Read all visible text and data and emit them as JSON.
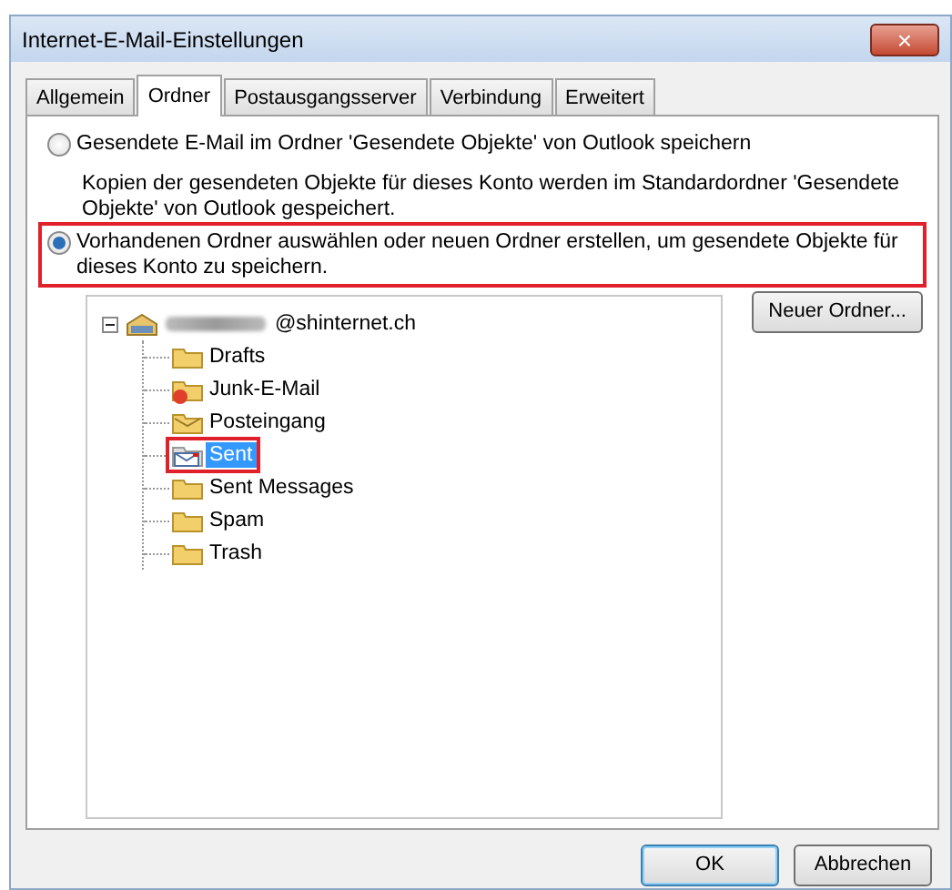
{
  "window": {
    "title": "Internet-E-Mail-Einstellungen",
    "close": "×"
  },
  "tabs": [
    {
      "label": "Allgemein",
      "selected": false
    },
    {
      "label": "Ordner",
      "selected": true
    },
    {
      "label": "Postausgangsserver",
      "selected": false
    },
    {
      "label": "Verbindung",
      "selected": false
    },
    {
      "label": "Erweitert",
      "selected": false
    }
  ],
  "options": [
    {
      "label": "Gesendete E-Mail im Ordner 'Gesendete Objekte' von Outlook speichern",
      "selected": false,
      "highlighted": false,
      "description": "Kopien der gesendeten Objekte für dieses Konto werden im Standardordner 'Gesendete Objekte' von Outlook gespeichert."
    },
    {
      "label": "Vorhandenen Ordner auswählen oder neuen Ordner erstellen, um gesendete Objekte für dieses Konto zu speichern.",
      "selected": true,
      "highlighted": true
    }
  ],
  "tree": {
    "label": "@shinternet.ch",
    "expanded": true,
    "children": [
      {
        "label": "Drafts",
        "kind": "folder",
        "selected": false,
        "highlighted": false
      },
      {
        "label": "Junk-E-Mail",
        "kind": "junk",
        "selected": false,
        "highlighted": false
      },
      {
        "label": "Posteingang",
        "kind": "inbox",
        "selected": false,
        "highlighted": false
      },
      {
        "label": "Sent",
        "kind": "sent",
        "selected": true,
        "highlighted": true
      },
      {
        "label": "Sent Messages",
        "kind": "folder",
        "selected": false,
        "highlighted": false
      },
      {
        "label": "Spam",
        "kind": "folder",
        "selected": false,
        "highlighted": false
      },
      {
        "label": "Trash",
        "kind": "folder",
        "selected": false,
        "highlighted": false
      }
    ]
  },
  "new_folder_button": "Neuer Ordner...",
  "buttons": [
    {
      "label": "OK",
      "default": true
    },
    {
      "label": "Abbrechen",
      "default": false
    }
  ]
}
